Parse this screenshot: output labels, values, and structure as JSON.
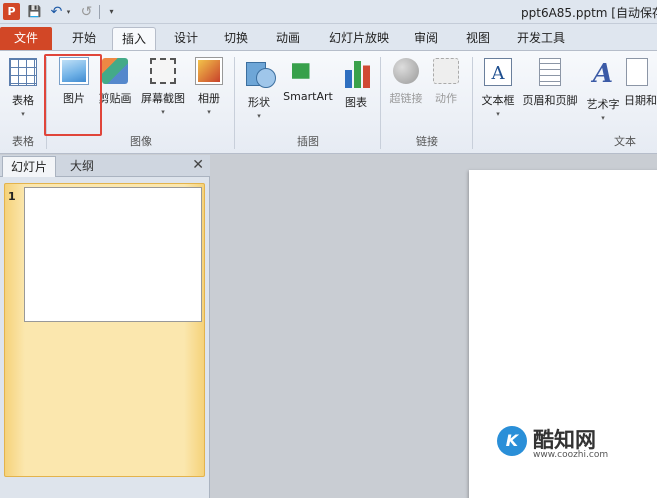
{
  "titlebar": {
    "app_icon": "P",
    "save_icon": "💾",
    "undo_icon": "↶",
    "undo_dropdown": "▾",
    "redo_icon": "↺",
    "customize_icon": "▾",
    "document_title": "ppt6A85.pptm [自动保存"
  },
  "tabs": {
    "file": "文件",
    "home": "开始",
    "insert": "插入",
    "design": "设计",
    "transitions": "切换",
    "animations": "动画",
    "slideshow": "幻灯片放映",
    "review": "审阅",
    "view": "视图",
    "developer": "开发工具"
  },
  "ribbon": {
    "caret": "▾",
    "table": "表格",
    "picture": "图片",
    "clipart": "剪贴画",
    "screenshot": "屏幕截图",
    "album": "相册",
    "shapes": "形状",
    "smartart": "SmartArt",
    "chart": "图表",
    "hyperlink": "超链接",
    "action": "动作",
    "textbox": "文本框",
    "header_footer": "页眉和页脚",
    "wordart": "艺术字",
    "datetime": "日期和",
    "textbox_glyph": "A",
    "wordart_glyph": "A",
    "groups": {
      "tables": "表格",
      "images": "图像",
      "illustrations": "插图",
      "links": "链接",
      "text": "文本"
    }
  },
  "pane": {
    "tab_slides": "幻灯片",
    "tab_outline": "大纲",
    "close": "✕",
    "slide_number": "1"
  },
  "watermark": {
    "logo_letter": "K",
    "text": "酷知网",
    "url": "www.coozhi.com"
  }
}
